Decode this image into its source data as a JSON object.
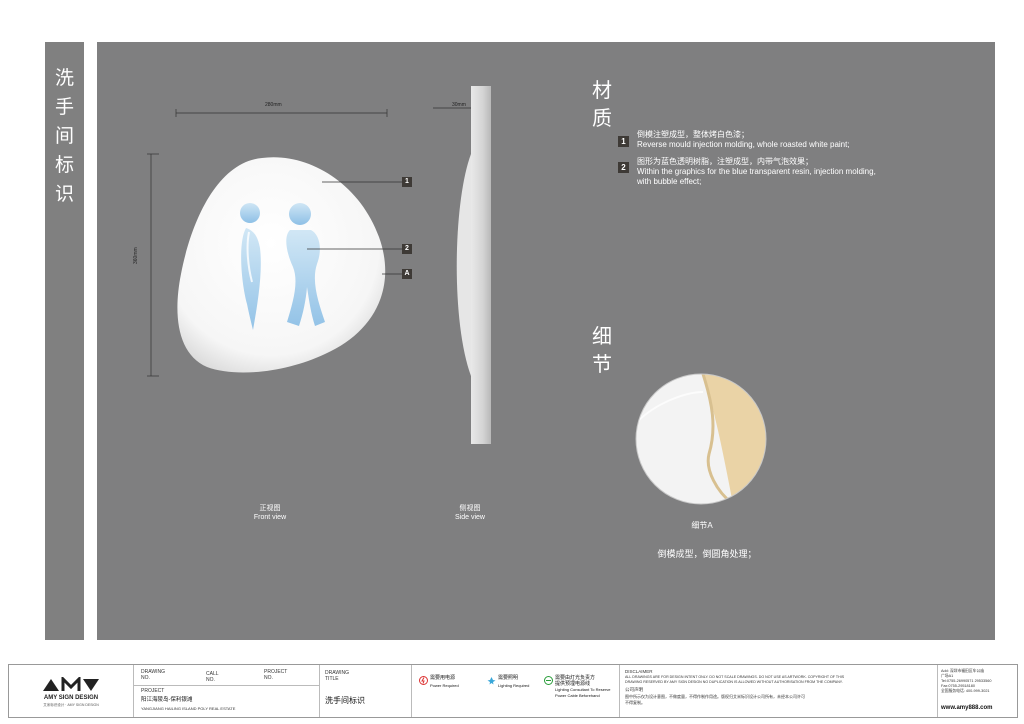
{
  "left_strip": {
    "title_chars": [
      "洗",
      "手",
      "间",
      "标",
      "识"
    ]
  },
  "dimensions": {
    "width": "280mm",
    "height": "360mm",
    "depth": "30mm"
  },
  "callouts": {
    "c1": "1",
    "c2": "2",
    "cA": "A"
  },
  "views": {
    "front_cn": "正视图",
    "front_en": "Front view",
    "side_cn": "侧视图",
    "side_en": "Side view"
  },
  "material": {
    "title_chars": [
      "材",
      "质"
    ],
    "items": [
      {
        "num": "1",
        "cn": "倒模注塑成型，整体烤白色漆；",
        "en": [
          "Reverse mould injection molding, whole roasted white paint;"
        ]
      },
      {
        "num": "2",
        "cn": "图形为蓝色透明树脂，注塑成型，内带气泡效果；",
        "en": [
          "Within the graphics for the blue transparent resin, injection molding,",
          "with bubble effect;"
        ]
      }
    ]
  },
  "detail": {
    "title_chars": [
      "细",
      "节"
    ],
    "label": "细节A",
    "note": "倒模成型，倒圆角处理；"
  },
  "footer": {
    "logo_text": "AMY SIGN DESIGN",
    "logo_sub": "艾米标识设计 · AMY SIGN DESIGN",
    "drawing_no_label": "DRAWING",
    "drawing_no_label2": "NO.",
    "call_no_label": "CALL",
    "call_no_label2": "NO.",
    "project_no_label": "PROJECT",
    "project_no_label2": "NO.",
    "project_label": "PROJECT",
    "project_cn": "阳江海陵岛-保利银滩",
    "project_en": "YANGJIANG HAILING ISLAND POLY REAL ESTATE",
    "title_label": "DRAWING",
    "title_label2": "TITLE",
    "title_value": "洗手间标识",
    "req1_cn": "需要用电源",
    "req1_en": "Power Required",
    "req2_cn": "需要照明",
    "req2_en": "Lighting Required",
    "req3_cn": "需要由灯光负责方",
    "req3_cn2": "提供预埋电源线",
    "req3_en": "Lighting Consultant To Reserve",
    "req3_en2": "Power Cable Beforehand",
    "disclaimer_label": "DISCLAIMER",
    "disclaimer_en": [
      "ALL DRAWINGS ARE FOR DESIGN INTENT ONLY. DO NOT SCALE DRAWINGS. DO NOT USE AS ARTWORK. COPYRIGHT OF THIS",
      "DRAWING RESERVED BY AMY SIGN DESIGN NO DUPLICATION IS ALLOWED WITHOUT AUTHORISATION FROM THE COMPANY."
    ],
    "disclaimer_cn_label": "公司声明",
    "disclaimer_cn": [
      "图中所示仅为设计意图，不做度量，不得作制作用途。版权归艾米标识设计公司所有，未经本公司许可",
      "不得复制。"
    ],
    "addr": [
      "Add: 深圳市福田区车公庙",
      "广场A1",
      "Tel:0755-26990571  29533560",
      "Fax:0755-29518180",
      "全国服务电话: 400-999-3021"
    ],
    "website": "www.amy888.com"
  }
}
